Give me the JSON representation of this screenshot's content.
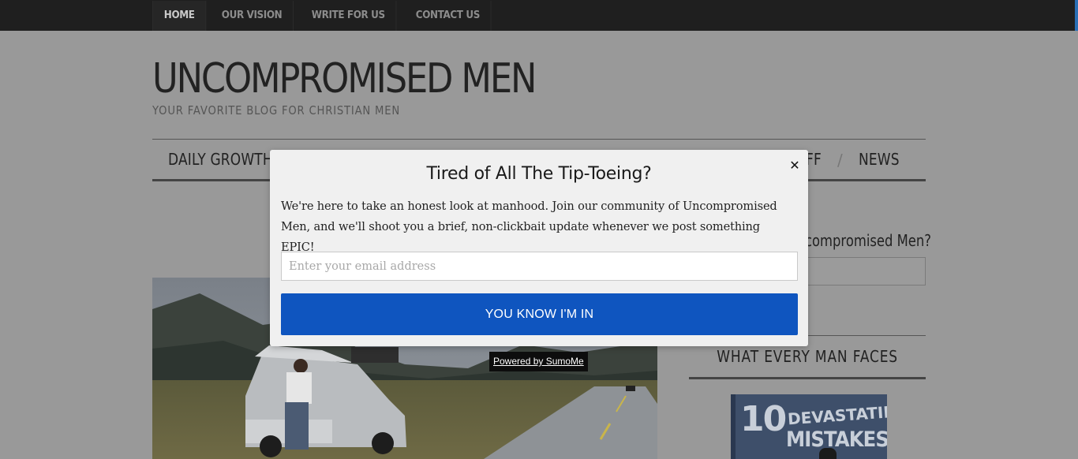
{
  "top_nav": {
    "items": [
      {
        "label": "HOME",
        "active": true
      },
      {
        "label": "OUR VISION",
        "active": false
      },
      {
        "label": "WRITE FOR US",
        "active": false
      },
      {
        "label": "CONTACT US",
        "active": false
      }
    ]
  },
  "header": {
    "site_title": "UNCOMPROMISED MEN",
    "tagline": "YOUR FAVORITE BLOG FOR CHRISTIAN MEN"
  },
  "main_nav": {
    "first_item": "DAILY GROWTH",
    "partial_item": "FF",
    "separator": "/",
    "last_item": "NEWS"
  },
  "sidebar": {
    "subscribe_heading_partial": "compromised Men?",
    "widget_title": "WHAT EVERY MAN FACES",
    "book": {
      "number": "10",
      "line1": "DEVASTATING",
      "line2": "MISTAKES"
    }
  },
  "popup": {
    "title": "Tired of All The Tip-Toeing?",
    "body": "We're here to take an honest look at manhood. Join our community of Uncompromised Men, and we'll shoot you a brief, non-clickbait update whenever we post something EPIC!",
    "email_placeholder": "Enter your email address",
    "email_value": "",
    "button_label": "YOU KNOW I'M IN",
    "close_icon": "close-icon",
    "powered_by": "Powered by SumoMe"
  },
  "colors": {
    "overlay_background": "#999999",
    "top_bar": "#1f1f1f",
    "popup_background": "#f0f0f0",
    "button_primary": "#0f55bf"
  }
}
